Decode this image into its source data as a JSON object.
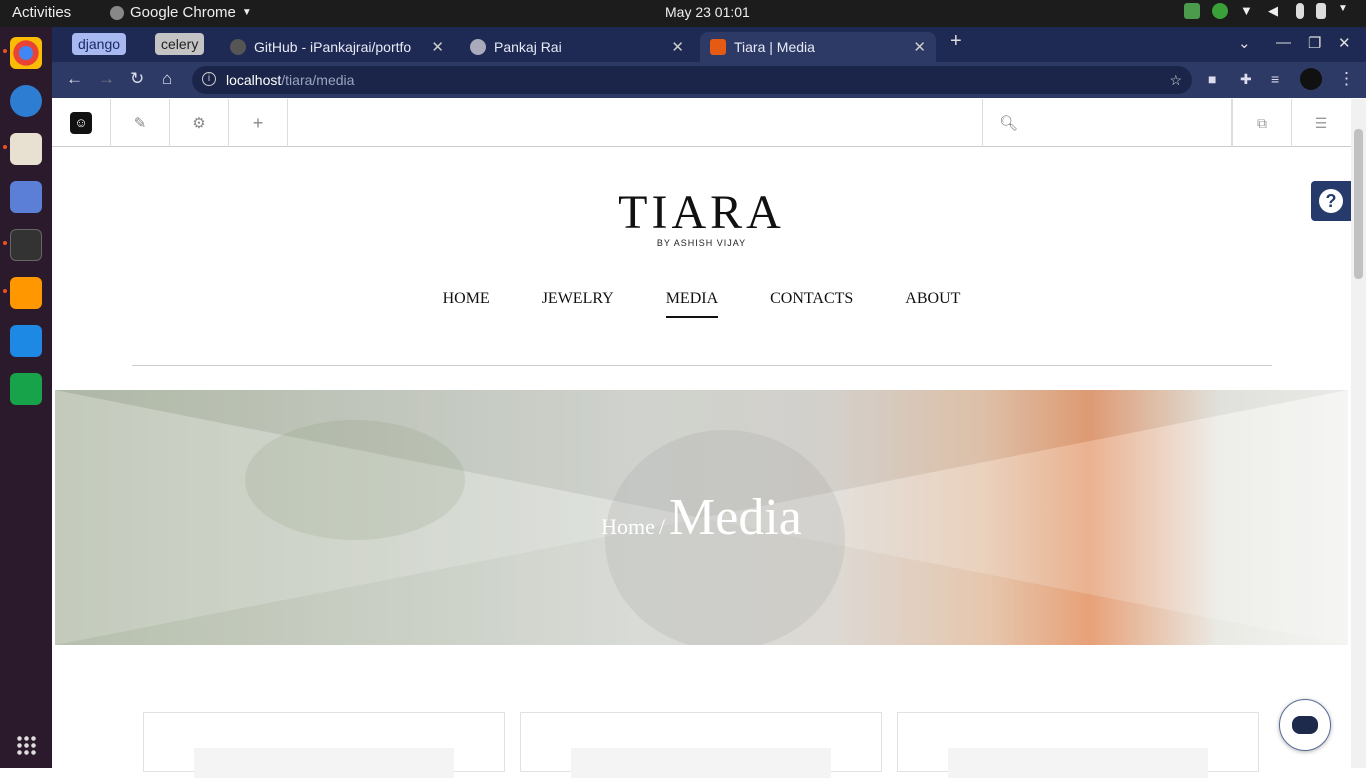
{
  "system": {
    "activities": "Activities",
    "app_name": "Google Chrome",
    "clock": "May 23  01:01"
  },
  "browser": {
    "tab_groups": [
      "django",
      "celery"
    ],
    "tabs": [
      {
        "title": "GitHub - iPankajrai/portfo"
      },
      {
        "title": "Pankaj Rai"
      },
      {
        "title": "Tiara | Media"
      }
    ],
    "address": {
      "host": "localhost",
      "path": "/tiara/media"
    }
  },
  "site": {
    "brand": "TIARA",
    "brand_sub": "BY ASHISH VIJAY",
    "nav": [
      "HOME",
      "JEWELRY",
      "MEDIA",
      "CONTACTS",
      "ABOUT"
    ],
    "active_nav": "MEDIA",
    "breadcrumb_home": "Home",
    "breadcrumb_sep": "/",
    "page_title": "Media"
  },
  "colors": {
    "chrome_frame": "#1e2a54",
    "help_button": "#263a6b"
  }
}
